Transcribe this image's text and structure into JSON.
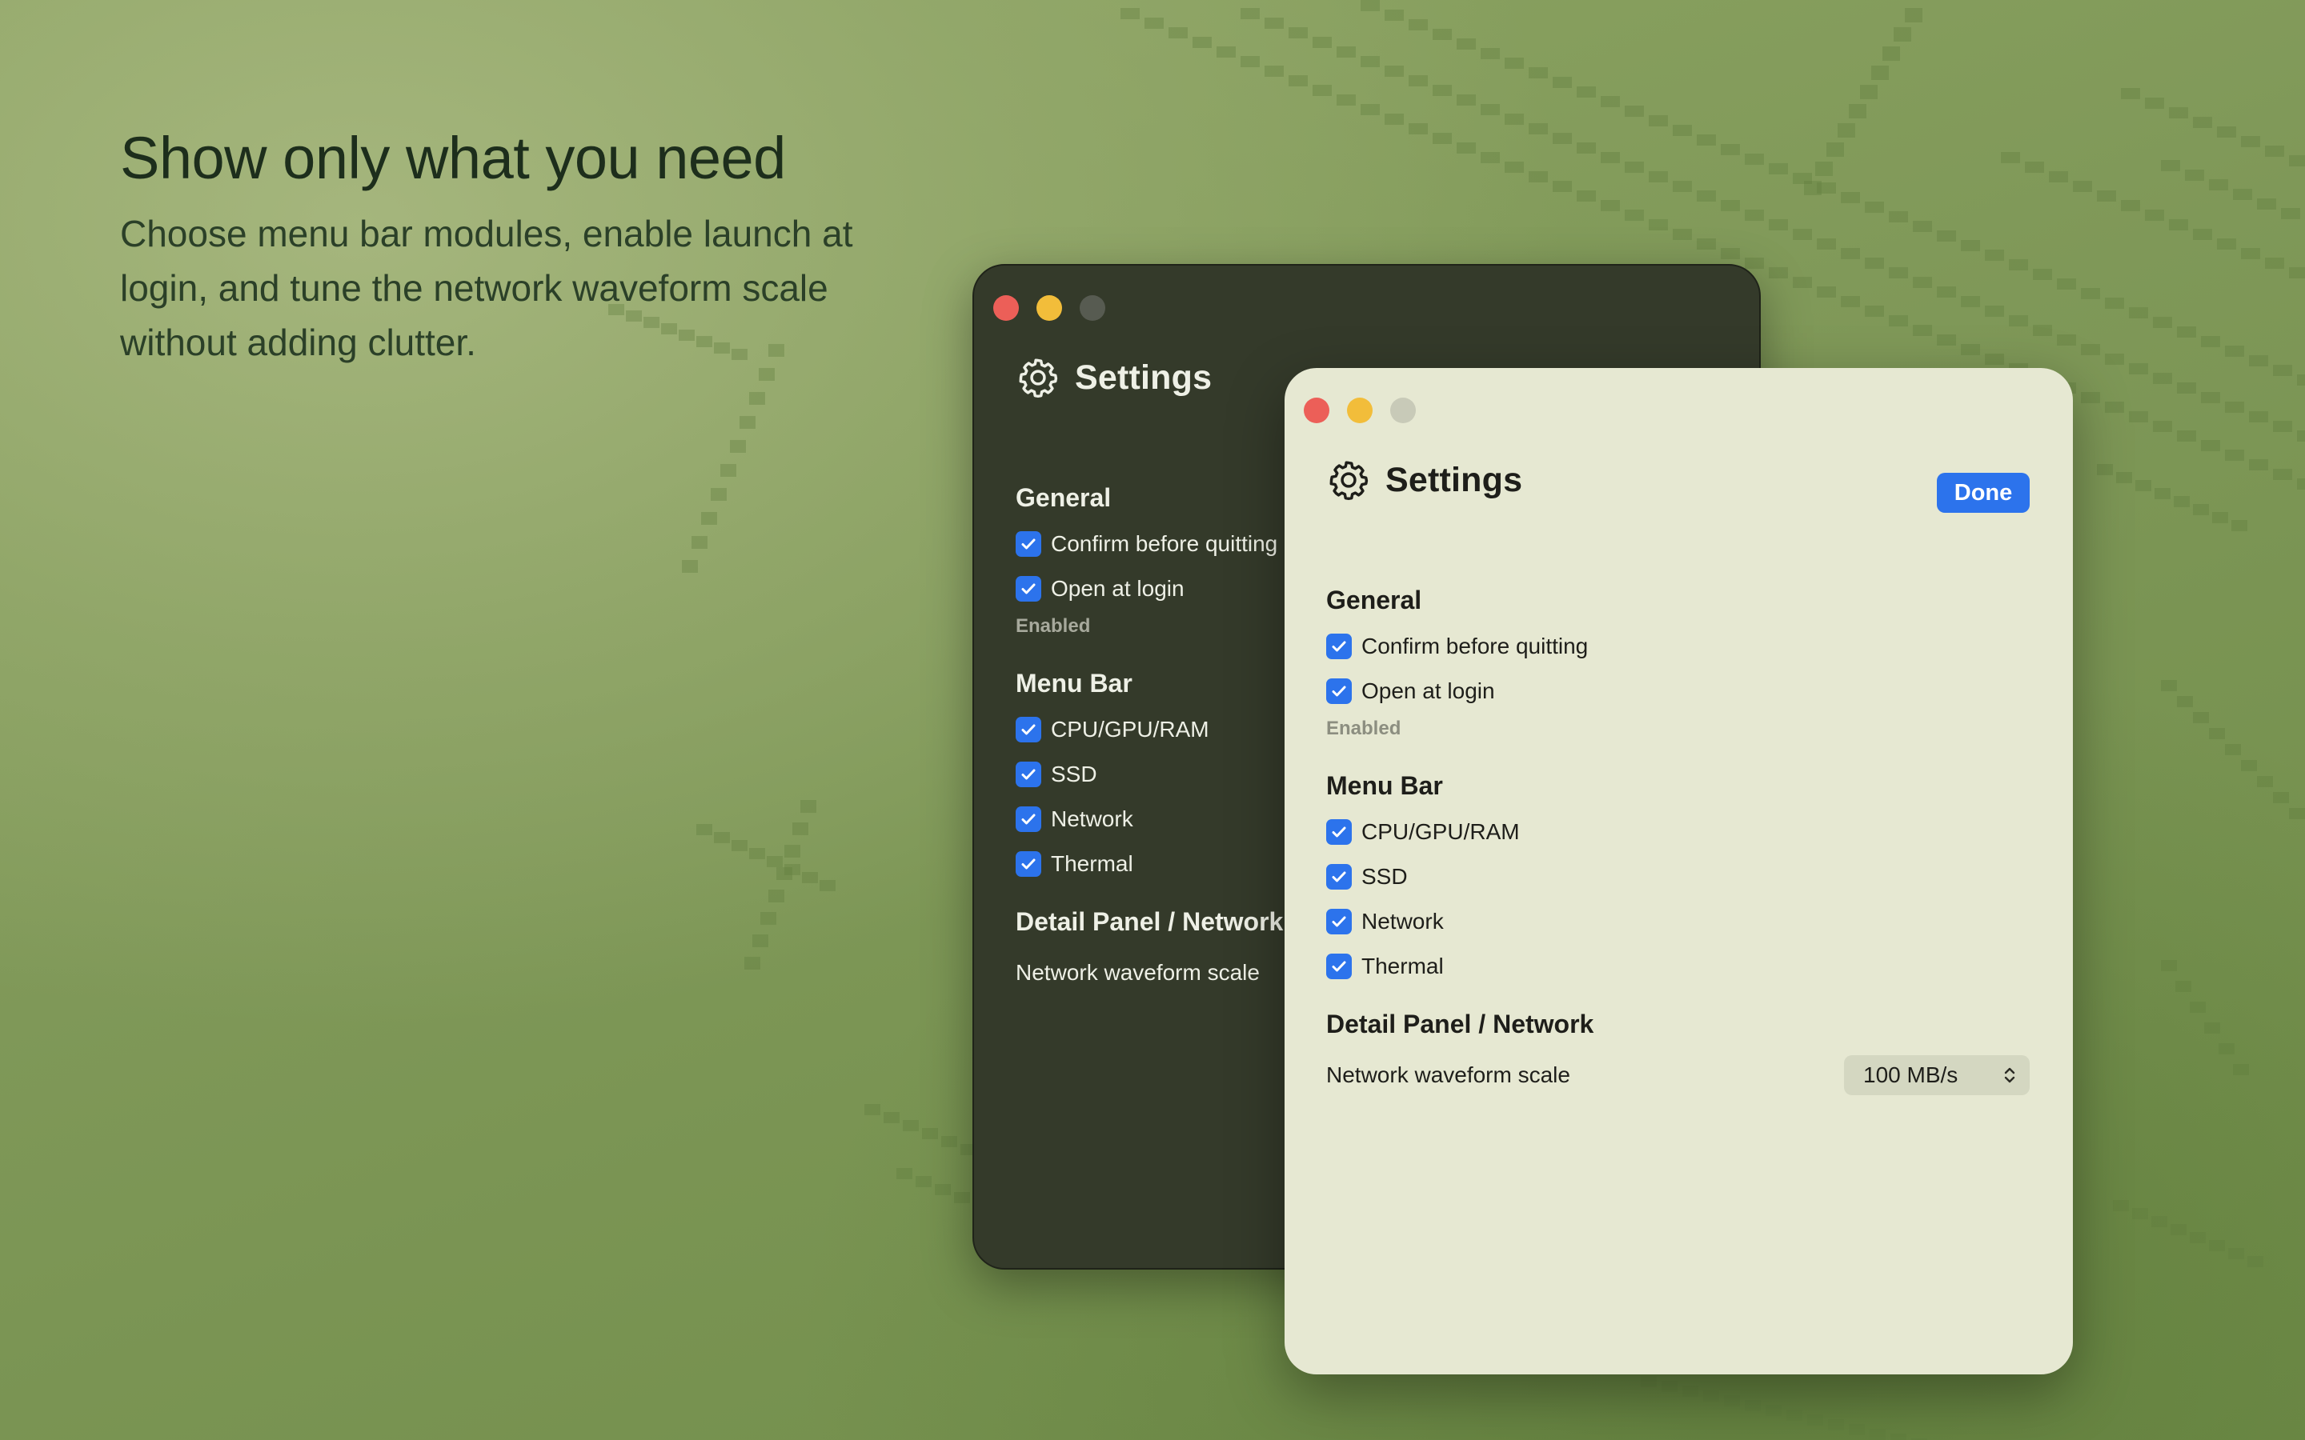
{
  "headline": {
    "title": "Show only what you need",
    "lines": [
      "Choose menu bar modules, enable launch at",
      "login, and tune the network waveform scale",
      "without adding clutter."
    ]
  },
  "colors": {
    "accent": "#2c73ec",
    "dark_window_bg": "#343a2a",
    "light_window_bg": "#e6e8d2",
    "background": "#7f9858"
  },
  "icons": {
    "header": "gear-icon",
    "checkbox": "checkmark-icon",
    "select": "chevron-up-down-icon"
  },
  "settings": {
    "title": "Settings",
    "done_label": "Done",
    "general": {
      "title": "General",
      "confirm_quit": "Confirm before quitting",
      "open_login": "Open at login",
      "login_status": "Enabled"
    },
    "menu_bar": {
      "title": "Menu Bar",
      "items": [
        "CPU/GPU/RAM",
        "SSD",
        "Network",
        "Thermal"
      ]
    },
    "detail_panel": {
      "title": "Detail Panel / Network",
      "waveform_label": "Network waveform scale",
      "waveform_value": "100 MB/s"
    }
  }
}
